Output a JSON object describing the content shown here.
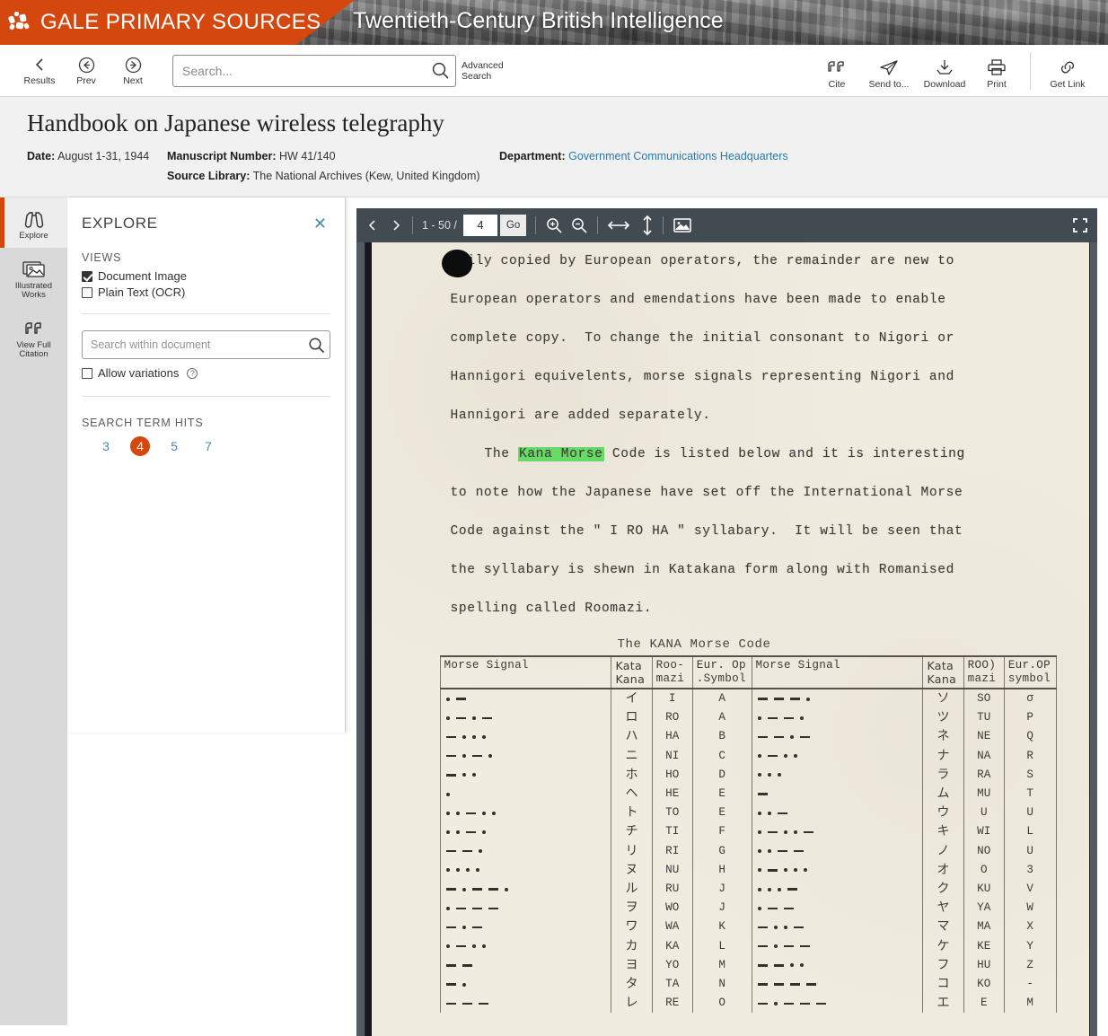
{
  "banner": {
    "brand": "GALE PRIMARY SOURCES",
    "archive": "Twentieth-Century British Intelligence",
    "logo_icon": "gale-logo-icon"
  },
  "navbar": {
    "back_items": [
      {
        "label": "Results",
        "icon": "chevron-left-icon"
      },
      {
        "label": "Prev",
        "icon": "circle-arrow-left-icon"
      },
      {
        "label": "Next",
        "icon": "circle-arrow-right-icon"
      }
    ],
    "search": {
      "value": "",
      "placeholder": "Search...",
      "icon": "search-icon"
    },
    "advanced_search": "Advanced\nSearch",
    "tools": [
      {
        "label": "Cite",
        "icon": "quote-icon"
      },
      {
        "label": "Send to...",
        "icon": "paper-plane-icon"
      },
      {
        "label": "Download",
        "icon": "download-icon"
      },
      {
        "label": "Print",
        "icon": "printer-icon"
      },
      {
        "label": "Get Link",
        "icon": "link-icon"
      }
    ]
  },
  "document_meta": {
    "title": "Handbook on Japanese wireless telegraphy",
    "date_label": "Date:",
    "date_value": "August 1-31, 1944",
    "manuscript_label": "Manuscript Number:",
    "manuscript_value": "HW 41/140",
    "source_library_label": "Source Library:",
    "source_library_value": "The National Archives (Kew, United Kingdom)",
    "department_label": "Department:",
    "department_value": "Government Communications Headquarters"
  },
  "rail": {
    "items": [
      {
        "label": "Explore",
        "icon": "binoculars-icon",
        "active": true
      },
      {
        "label": "Illustrated\nWorks",
        "icon": "image-stack-icon",
        "active": false
      },
      {
        "label": "View Full\nCitation",
        "icon": "quote-icon",
        "active": false
      }
    ]
  },
  "explore_panel": {
    "title": "EXPLORE",
    "close_icon": "close-icon",
    "views_title": "VIEWS",
    "views": [
      {
        "label": "Document Image",
        "checked": true
      },
      {
        "label": "Plain Text (OCR)",
        "checked": false
      }
    ],
    "doc_search": {
      "value": "",
      "placeholder": "Search within document",
      "icon": "search-icon"
    },
    "allow_variations": {
      "label": "Allow variations",
      "checked": false,
      "help_icon": "help-icon"
    },
    "hits_title": "SEARCH TERM HITS",
    "hits": [
      {
        "label": "3",
        "active": false
      },
      {
        "label": "4",
        "active": true
      },
      {
        "label": "5",
        "active": false
      },
      {
        "label": "7",
        "active": false
      }
    ]
  },
  "viewer_toolbar": {
    "prev_icon": "chevron-left-icon",
    "next_icon": "chevron-right-icon",
    "page_range": "1 - 50 /",
    "page_value": "4",
    "go_label": "Go",
    "zoom_in_icon": "zoom-in-icon",
    "zoom_out_icon": "zoom-out-icon",
    "fit_width_icon": "fit-width-icon",
    "fit_height_icon": "fit-height-icon",
    "thumbnail_icon": "image-icon",
    "fullscreen_icon": "fullscreen-icon"
  },
  "scanned_page": {
    "paragraphs": [
      {
        "lines": [
          "asily copied by European operators, the remainder are new to",
          "European operators and emendations have been made to enable",
          "complete copy.  To change the initial consonant to Nigori or",
          "Hannigori equivelents, morse signals representing Nigori and",
          "Hannigori are added separately."
        ]
      }
    ],
    "highlight_line": {
      "before": "The ",
      "highlight": "Kana Morse",
      "after": " Code is listed below and it is interesting"
    },
    "para2_rest": [
      "to note how the Japanese have set off the International Morse",
      "Code against the \" I RO HA \" syllabary.  It will be seen that",
      "the syllabary is shewn in Katakana form along with Romanised",
      "spelling called Roomazi."
    ],
    "table_title": "The KANA Morse Code",
    "table_headers_left": [
      "Morse Signal",
      "Kata\nKana",
      "Roo-\nmazi",
      "Eur. Op\n.Symbol"
    ],
    "table_headers_right": [
      "Morse Signal",
      "Kata\nKana",
      "ROO)\nmazi",
      "Eur.OP\nsymbol"
    ],
    "rows_left": [
      {
        "morse": ".-",
        "kana": "イ",
        "roomazi": "I",
        "eur": "A"
      },
      {
        "morse": ".-.-",
        "kana": "ロ",
        "roomazi": "RO",
        "eur": "A"
      },
      {
        "morse": "-...",
        "kana": "ハ",
        "roomazi": "HA",
        "eur": "B"
      },
      {
        "morse": "-.-.",
        "kana": "ニ",
        "roomazi": "NI",
        "eur": "C"
      },
      {
        "morse": "-..",
        "kana": "ホ",
        "roomazi": "HO",
        "eur": "D"
      },
      {
        "morse": ".",
        "kana": "ヘ",
        "roomazi": "HE",
        "eur": "E"
      },
      {
        "morse": "..-..",
        "kana": "ト",
        "roomazi": "TO",
        "eur": "E"
      },
      {
        "morse": "..-.",
        "kana": "チ",
        "roomazi": "TI",
        "eur": "F"
      },
      {
        "morse": "--.",
        "kana": "リ",
        "roomazi": "RI",
        "eur": "G"
      },
      {
        "morse": "....",
        "kana": "ヌ",
        "roomazi": "NU",
        "eur": "H"
      },
      {
        "morse": "-.--.",
        "kana": "ル",
        "roomazi": "RU",
        "eur": "J"
      },
      {
        "morse": ".---",
        "kana": "ヲ",
        "roomazi": "WO",
        "eur": "J"
      },
      {
        "morse": "-.-",
        "kana": "ワ",
        "roomazi": "WA",
        "eur": "K"
      },
      {
        "morse": ".-..",
        "kana": "カ",
        "roomazi": "KA",
        "eur": "L"
      },
      {
        "morse": "--",
        "kana": "ヨ",
        "roomazi": "YO",
        "eur": "M"
      },
      {
        "morse": "-.",
        "kana": "タ",
        "roomazi": "TA",
        "eur": "N"
      },
      {
        "morse": "---",
        "kana": "レ",
        "roomazi": "RE",
        "eur": "O"
      }
    ],
    "rows_right": [
      {
        "morse": "---.",
        "kana": "ソ",
        "roomazi": "SO",
        "eur": "σ"
      },
      {
        "morse": ".--.",
        "kana": "ツ",
        "roomazi": "TU",
        "eur": "P"
      },
      {
        "morse": "--.-",
        "kana": "ネ",
        "roomazi": "NE",
        "eur": "Q"
      },
      {
        "morse": ".-..",
        "kana": "ナ",
        "roomazi": "NA",
        "eur": "R"
      },
      {
        "morse": "...",
        "kana": "ラ",
        "roomazi": "RA",
        "eur": "S"
      },
      {
        "morse": "-",
        "kana": "ム",
        "roomazi": "MU",
        "eur": "T"
      },
      {
        "morse": "..-",
        "kana": "ウ",
        "roomazi": "U",
        "eur": "U"
      },
      {
        "morse": ".-..-",
        "kana": "キ",
        "roomazi": "WI",
        "eur": "L"
      },
      {
        "morse": "..--",
        "kana": "ノ",
        "roomazi": "NO",
        "eur": "U"
      },
      {
        "morse": ".-...",
        "kana": "オ",
        "roomazi": "O",
        "eur": "3"
      },
      {
        "morse": "...-",
        "kana": "ク",
        "roomazi": "KU",
        "eur": "V"
      },
      {
        "morse": ".--",
        "kana": "ヤ",
        "roomazi": "YA",
        "eur": "W"
      },
      {
        "morse": "-..-",
        "kana": "マ",
        "roomazi": "MA",
        "eur": "X"
      },
      {
        "morse": "-.--",
        "kana": "ケ",
        "roomazi": "KE",
        "eur": "Y"
      },
      {
        "morse": "--..",
        "kana": "フ",
        "roomazi": "HU",
        "eur": "Z"
      },
      {
        "morse": "----",
        "kana": "コ",
        "roomazi": "KO",
        "eur": "-"
      },
      {
        "morse": "-.---",
        "kana": "エ",
        "roomazi": "E",
        "eur": "M"
      }
    ]
  },
  "colors": {
    "brand_orange": "#d4480f",
    "link_blue": "#2a7ab0",
    "highlight_green": "#66e066",
    "viewer_toolbar": "#424a52",
    "viewer_bg": "#545b63"
  }
}
